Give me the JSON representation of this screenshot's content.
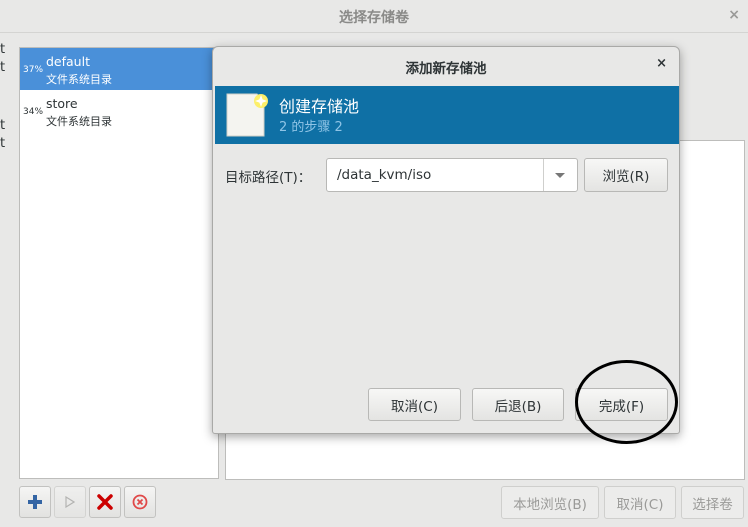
{
  "window": {
    "title": "选择存储卷",
    "close_icon": "×"
  },
  "cut_chars": [
    "t",
    "t",
    "t",
    "t"
  ],
  "pools": [
    {
      "usage": "37%",
      "name": "default",
      "type": "文件系统目录",
      "selected": true
    },
    {
      "usage": "34%",
      "name": "store",
      "type": "文件系统目录",
      "selected": false
    }
  ],
  "toolbar": {
    "add_icon": "plus-icon",
    "start_icon": "play-icon",
    "delete_icon": "delete-x-icon",
    "stop_icon": "stop-icon"
  },
  "footer": {
    "browse_local": "本地浏览(B)",
    "cancel": "取消(C)",
    "choose_volume": "选择卷"
  },
  "dialog": {
    "title": "添加新存储池",
    "close_icon": "×",
    "banner_title": "创建存储池",
    "banner_step": "2 的步骤 2",
    "target_label": "目标路径(T)：",
    "target_value": "/data_kvm/iso",
    "browse_button": "浏览(R)",
    "cancel_button": "取消(C)",
    "back_button": "后退(B)",
    "finish_button": "完成(F)"
  },
  "colors": {
    "selection": "#4a90d9",
    "banner": "#0f70a5"
  }
}
